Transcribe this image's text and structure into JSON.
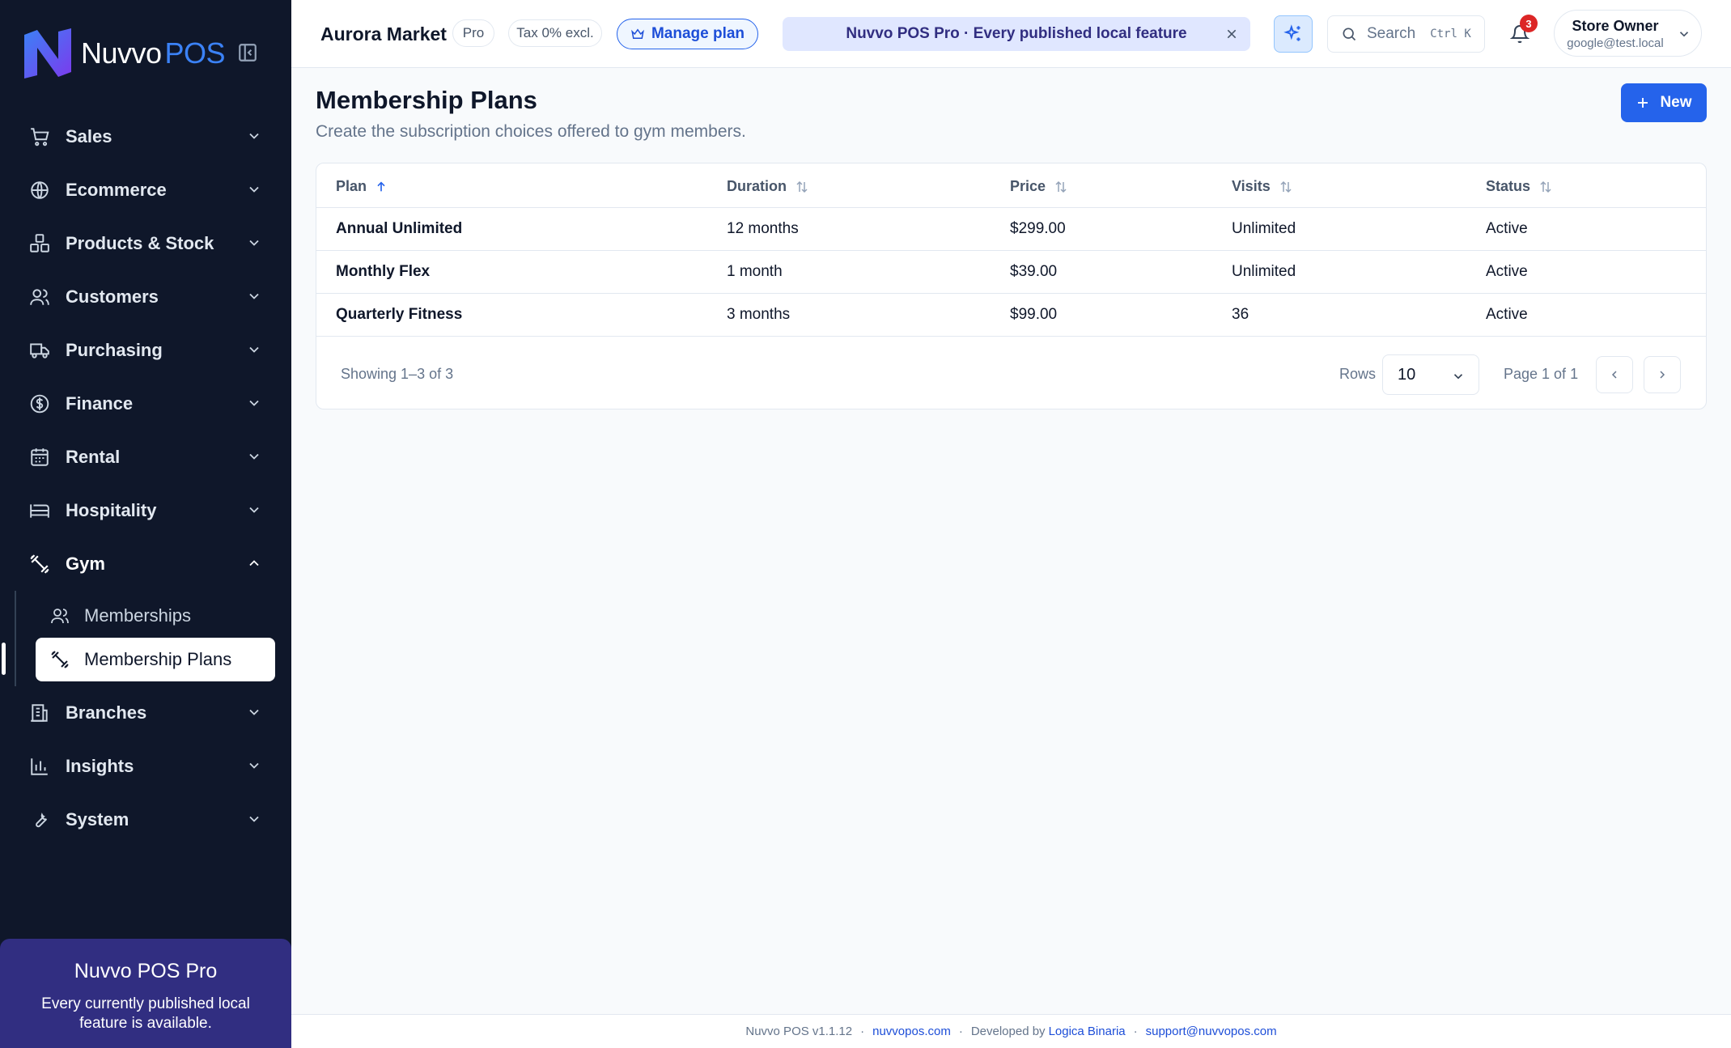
{
  "brand": {
    "name": "Nuvvo",
    "suffix": "POS"
  },
  "sidebar": {
    "items": [
      {
        "label": "Sales",
        "icon": "cart-icon"
      },
      {
        "label": "Ecommerce",
        "icon": "globe-icon"
      },
      {
        "label": "Products & Stock",
        "icon": "boxes-icon"
      },
      {
        "label": "Customers",
        "icon": "users-icon"
      },
      {
        "label": "Purchasing",
        "icon": "truck-icon"
      },
      {
        "label": "Finance",
        "icon": "dollar-icon"
      },
      {
        "label": "Rental",
        "icon": "calendar-icon"
      },
      {
        "label": "Hospitality",
        "icon": "bed-icon"
      },
      {
        "label": "Gym",
        "icon": "dumbbell-icon",
        "expanded": true
      },
      {
        "label": "Branches",
        "icon": "building-icon"
      },
      {
        "label": "Insights",
        "icon": "chart-icon"
      },
      {
        "label": "System",
        "icon": "wrench-icon"
      }
    ],
    "gym_sub": [
      {
        "label": "Memberships",
        "icon": "users-icon"
      },
      {
        "label": "Membership Plans",
        "icon": "dumbbell-icon",
        "active": true
      }
    ],
    "promo": {
      "title": "Nuvvo POS Pro",
      "text": "Every currently published local feature is available."
    }
  },
  "topbar": {
    "store_name": "Aurora Market",
    "plan_badge": "Pro",
    "tax_badge": "Tax 0% excl.",
    "manage_plan": "Manage plan",
    "banner": "Nuvvo POS Pro · Every published local feature",
    "search_placeholder": "Search",
    "search_shortcut": "Ctrl K",
    "notifications_count": "3",
    "user_name": "Store Owner",
    "user_email": "google@test.local"
  },
  "main": {
    "title": "Membership Plans",
    "subtitle": "Create the subscription choices offered to gym members.",
    "new_button": "New",
    "columns": [
      "Plan",
      "Duration",
      "Price",
      "Visits",
      "Status"
    ],
    "rows": [
      {
        "plan": "Annual Unlimited",
        "duration": "12 months",
        "price": "$299.00",
        "visits": "Unlimited",
        "status": "Active"
      },
      {
        "plan": "Monthly Flex",
        "duration": "1 month",
        "price": "$39.00",
        "visits": "Unlimited",
        "status": "Active"
      },
      {
        "plan": "Quarterly Fitness",
        "duration": "3 months",
        "price": "$99.00",
        "visits": "36",
        "status": "Active"
      }
    ],
    "showing": "Showing 1–3 of 3",
    "rows_label": "Rows",
    "rows_value": "10",
    "page_info": "Page 1 of 1"
  },
  "footer": {
    "version": "Nuvvo POS v1.1.12",
    "site": "nuvvopos.com",
    "developed_by": "Developed by",
    "developer": "Logica Binaria",
    "support": "support@nuvvopos.com"
  },
  "colors": {
    "sidebar_bg": "#0f172a",
    "accent": "#2563eb",
    "promo_bg": "#312e81",
    "badge_red": "#dc2626"
  }
}
